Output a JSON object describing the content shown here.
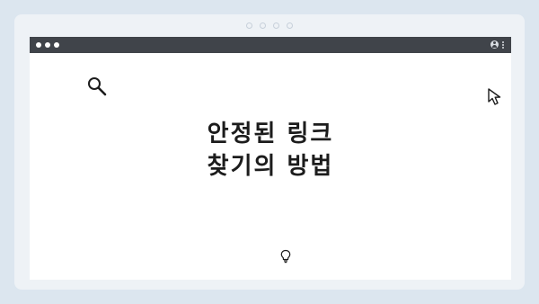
{
  "headline": {
    "line1": "안정된 링크",
    "line2": "찾기의 방법"
  },
  "icons": {
    "search": "search-icon",
    "cursor": "cursor-icon",
    "bulb": "lightbulb-icon",
    "user": "user-icon",
    "menu": "kebab-menu-icon"
  },
  "colors": {
    "background": "#dce6ef",
    "titlebar": "#40444a",
    "window": "#ffffff",
    "text": "#1c1c1c"
  }
}
